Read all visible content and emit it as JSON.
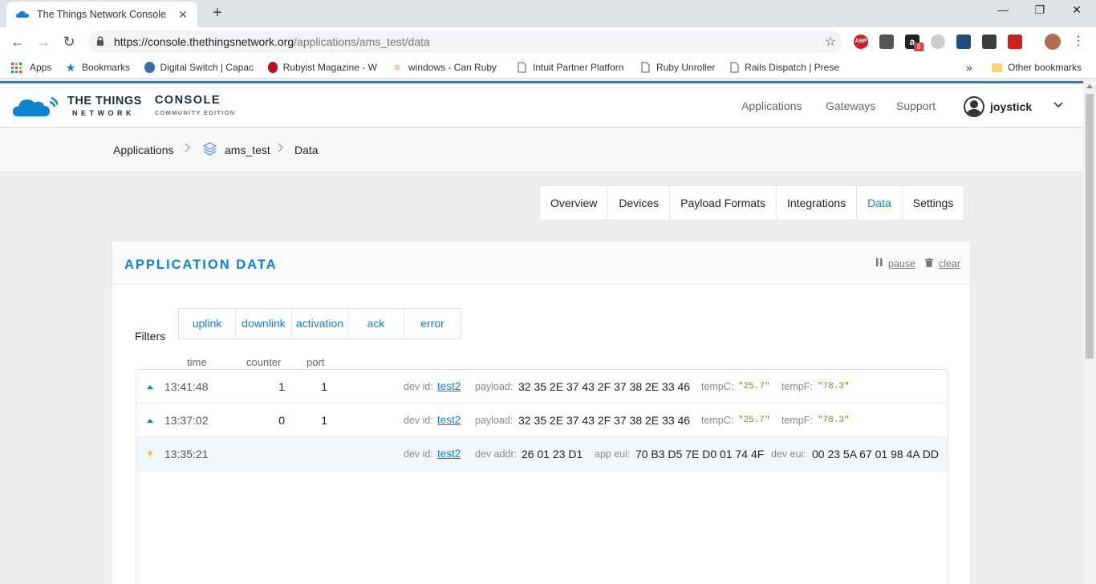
{
  "browser": {
    "tab_title": "The Things Network Console",
    "tab_close": "✕",
    "new_tab": "+",
    "url_host": "https://console.thethingsnetwork.org",
    "url_path": "/applications/ams_test/data",
    "back": "←",
    "forward": "→",
    "reload": "↻",
    "star": "☆",
    "minimize": "—",
    "restore": "❐",
    "close": "✕",
    "extensions": [
      {
        "name": "abp",
        "label": "ABP",
        "color": "#c8202c"
      },
      {
        "name": "pocket",
        "label": "",
        "color": "#555555"
      },
      {
        "name": "amazon",
        "label": "a",
        "color": "#222222"
      },
      {
        "name": "circle",
        "label": "",
        "color": "#bbbbbb"
      },
      {
        "name": "ext-5",
        "label": "",
        "color": "#1f4e7a"
      },
      {
        "name": "ext-6",
        "label": "",
        "color": "#3c3c3c"
      },
      {
        "name": "ext-7",
        "label": "",
        "color": "#cc2222"
      },
      {
        "name": "profile",
        "label": "",
        "color": "#b07050"
      }
    ],
    "menu": "⋮",
    "amazon_badge": "8"
  },
  "bookmarks": {
    "items": [
      {
        "label": "Apps"
      },
      {
        "label": "Bookmarks"
      },
      {
        "label": "Digital Switch | Capac"
      },
      {
        "label": "Rubyist Magazine - W"
      },
      {
        "label": "windows - Can Ruby"
      },
      {
        "label": "Intuit Partner Platforn"
      },
      {
        "label": "Ruby Unroller"
      },
      {
        "label": "Rails Dispatch | Prese"
      }
    ],
    "more": "»",
    "other": "Other bookmarks"
  },
  "header": {
    "logo_line1": "THE THINGS",
    "logo_line1_sub": "NETWORK",
    "logo_line2": "CONSOLE",
    "logo_line2_sub": "COMMUNITY EDITION",
    "nav": [
      "Applications",
      "Gateways",
      "Support"
    ],
    "username": "joystick",
    "chevron": "⌄"
  },
  "breadcrumb": {
    "items": [
      "Applications",
      "ams_test",
      "Data"
    ],
    "sep": ">"
  },
  "tabs": [
    {
      "label": "Overview"
    },
    {
      "label": "Devices"
    },
    {
      "label": "Payload Formats"
    },
    {
      "label": "Integrations"
    },
    {
      "label": "Data",
      "active": true
    },
    {
      "label": "Settings"
    }
  ],
  "card": {
    "title": "APPLICATION DATA",
    "pause": "pause",
    "clear": "clear",
    "pause_icon": "❚❚",
    "clear_icon": "🗑"
  },
  "filters": {
    "label": "Filters",
    "options": [
      "uplink",
      "downlink",
      "activation",
      "ack",
      "error"
    ]
  },
  "columns": {
    "time": "time",
    "counter": "counter",
    "port": "port"
  },
  "rows": [
    {
      "type": "uplink",
      "time": "13:41:48",
      "counter": "1",
      "port": "1",
      "dev_id_label": "dev id:",
      "dev_id": "test2",
      "payload_label": "payload:",
      "payload": "32 35 2E 37 43 2F 37 38 2E 33 46",
      "f1_label": "tempC:",
      "f1_value": "\"25.7\"",
      "f2_label": "tempF:",
      "f2_value": "\"78.3\""
    },
    {
      "type": "uplink",
      "time": "13:37:02",
      "counter": "0",
      "port": "1",
      "dev_id_label": "dev id:",
      "dev_id": "test2",
      "payload_label": "payload:",
      "payload": "32 35 2E 37 43 2F 37 38 2E 33 46",
      "f1_label": "tempC:",
      "f1_value": "\"25.7\"",
      "f2_label": "tempF:",
      "f2_value": "\"78.3\""
    },
    {
      "type": "activation",
      "time": "13:35:21",
      "dev_id_label": "dev id:",
      "dev_id": "test2",
      "dev_addr_label": "dev addr:",
      "dev_addr": "26 01 23 D1",
      "app_eui_label": "app eui:",
      "app_eui": "70 B3 D5 7E D0 01 74 4F",
      "dev_eui_label": "dev eui:",
      "dev_eui": "00 23 5A 67 01 98 4A DD"
    }
  ],
  "colors": {
    "accent": "#0d83d0",
    "uplink": "#0d83d0",
    "activation": "#f5b800",
    "code": "#6f8a2b"
  }
}
